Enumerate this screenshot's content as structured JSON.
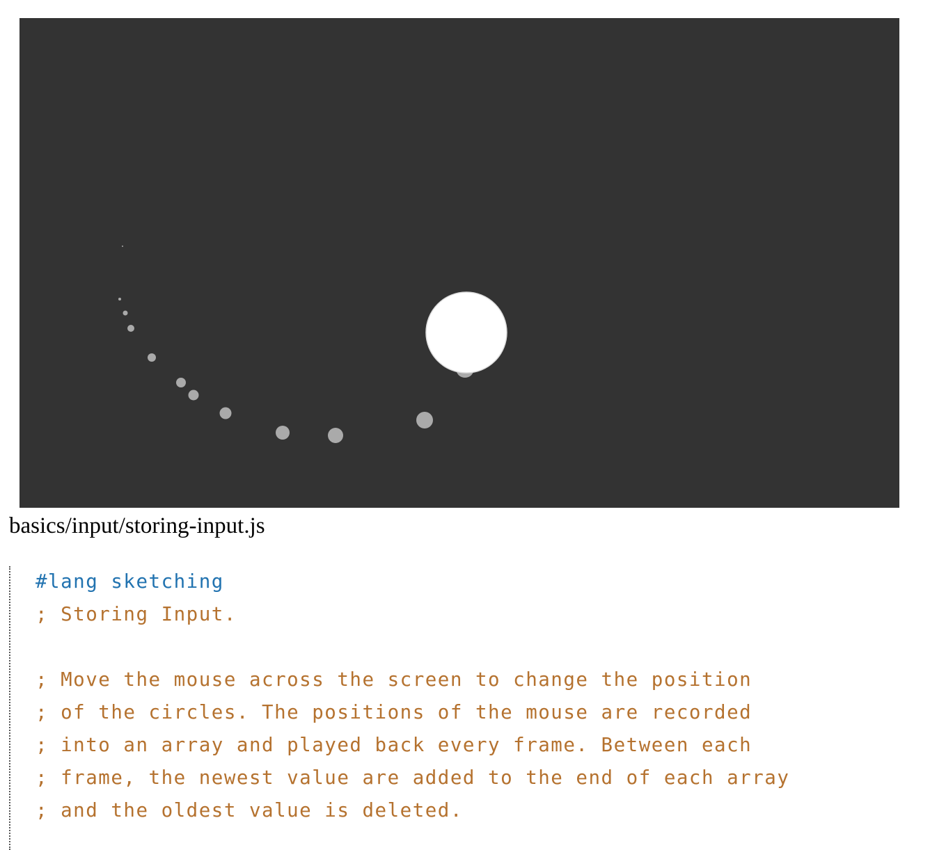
{
  "canvas": {
    "background": "#333333",
    "trail_color": "#aaaaaa",
    "cursor_color": "#ffffff",
    "trail_count": 13
  },
  "file_path": "basics/input/storing-input.js",
  "code": {
    "lang": "#lang sketching",
    "comments": [
      "; Storing Input.",
      "",
      "; Move the mouse across the screen to change the position",
      "; of the circles. The positions of the mouse are recorded",
      "; into an array and played back every frame. Between each",
      "; frame, the newest value are added to the end of each array",
      "; and the oldest value is deleted."
    ]
  },
  "colors": {
    "lang_keyword": "#2273b0",
    "comment": "#b5722f"
  }
}
